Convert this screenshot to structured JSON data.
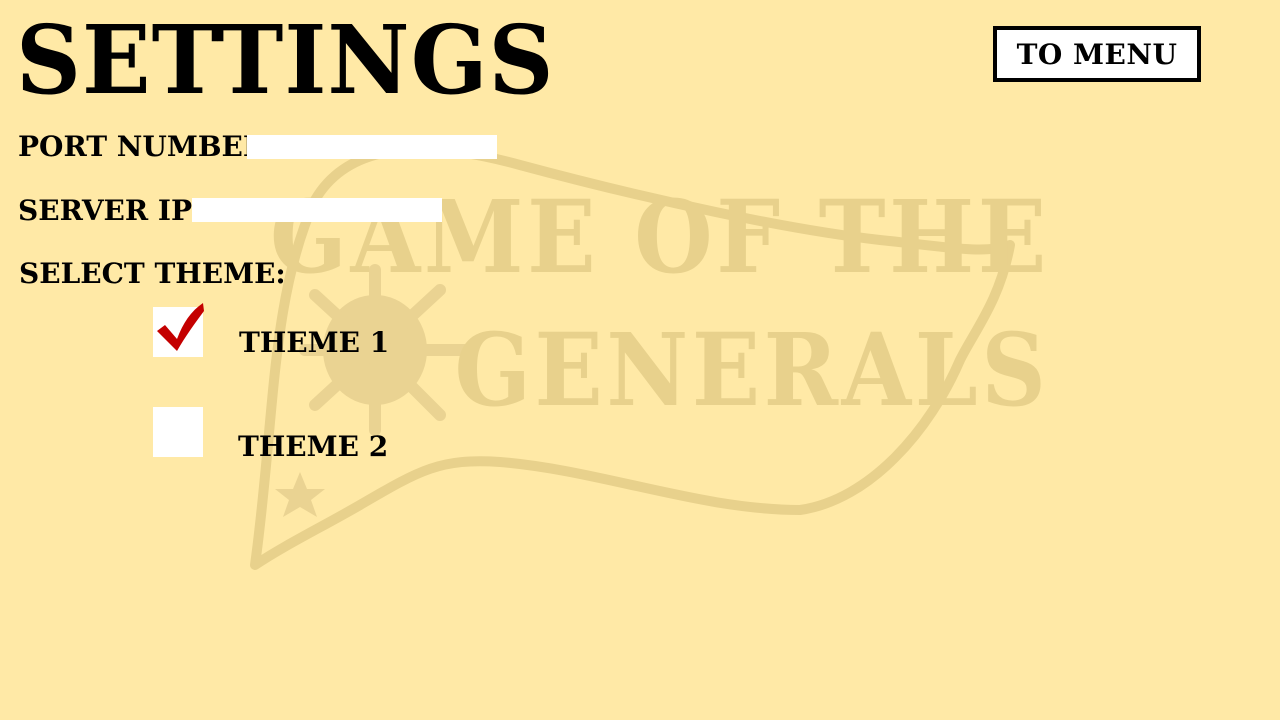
{
  "page": {
    "title": "SETTINGS",
    "menu_button": "TO MENU"
  },
  "watermark": {
    "line1": "GAME OF THE",
    "line2": "GENERALS"
  },
  "fields": {
    "port_label": "PORT NUMBER:",
    "port_value": "",
    "server_ip_label": "SERVER IP:",
    "server_ip_value": ""
  },
  "theme": {
    "section_label": "SELECT THEME:",
    "options": [
      {
        "label": "THEME 1",
        "checked": true
      },
      {
        "label": "THEME 2",
        "checked": false
      }
    ]
  },
  "colors": {
    "background": "#ffe9a6",
    "watermark": "#e8d18c",
    "checkmark": "#c40000"
  }
}
